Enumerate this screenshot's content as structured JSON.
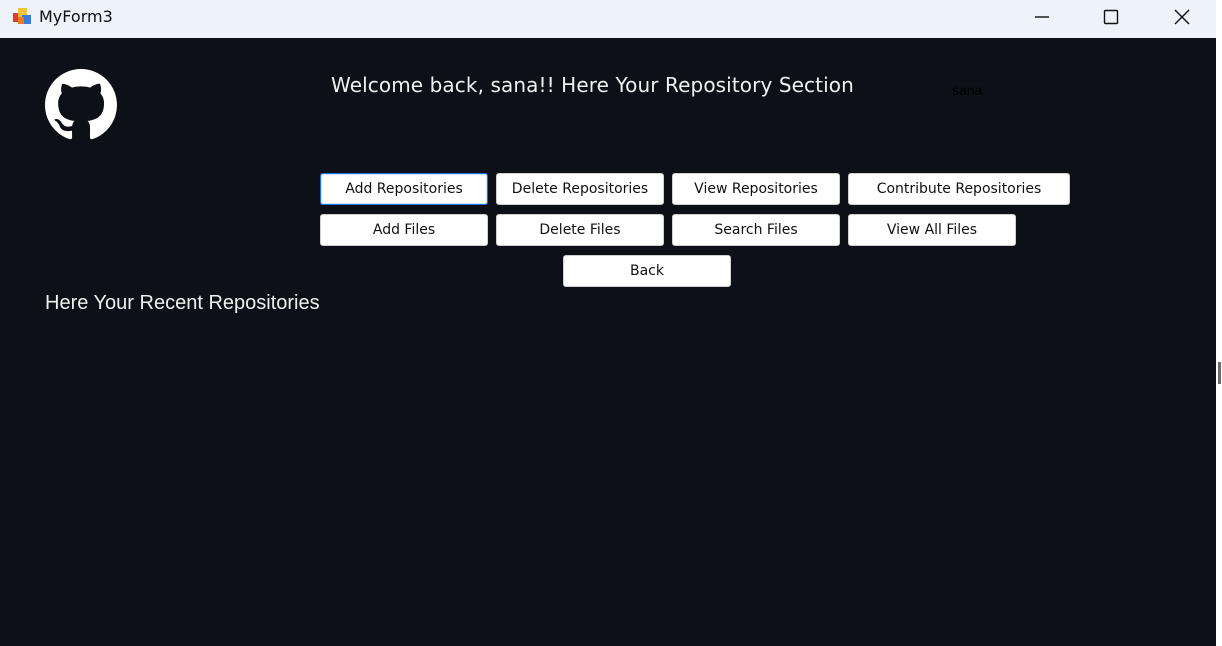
{
  "window": {
    "title": "MyForm3",
    "controls": [
      "minimize-icon",
      "maximize-icon",
      "close-icon"
    ]
  },
  "header": {
    "logo_icon": "github-icon",
    "welcome_text": "Welcome back, sana!! Here Your Repository Section",
    "username": "sana"
  },
  "actions": {
    "row1": [
      "Add Repositories",
      "Delete Repositories",
      "View Repositories",
      "Contribute Repositories"
    ],
    "row2": [
      "Add Files",
      "Delete Files",
      "Search Files",
      "View All Files"
    ],
    "back": "Back"
  },
  "recent": {
    "heading": "Here Your Recent Repositories"
  },
  "colors": {
    "background": "#0d1117",
    "titlebar": "#eef3f9",
    "button": "#ffffff",
    "focus_border": "#1a73e8"
  }
}
